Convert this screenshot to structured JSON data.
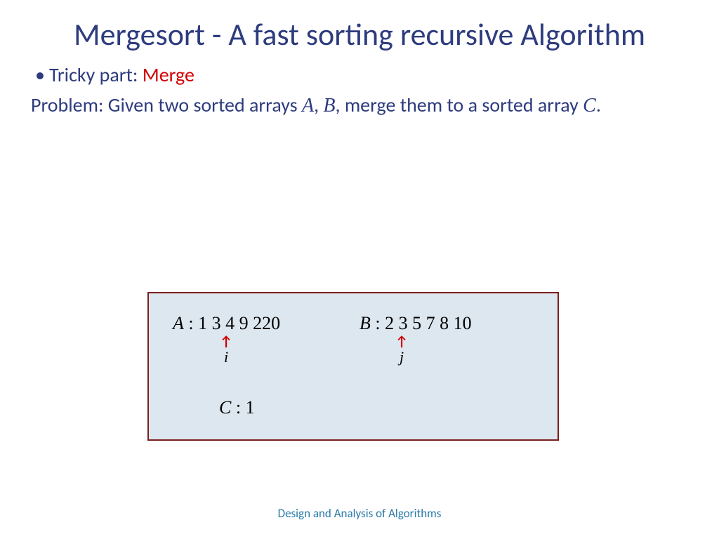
{
  "title": "Mergesort - A fast sorting recursive Algorithm",
  "bullet": {
    "prefix": "Tricky part: ",
    "emph": "Merge"
  },
  "problem": {
    "p1": "Problem: Given two sorted arrays ",
    "A": "A",
    "comma": ", ",
    "B": "B",
    "p2": ", merge them to a sorted array ",
    "C": "C",
    "period": "."
  },
  "diagram": {
    "A_label": "A",
    "A_values": "1 3 4 9 220",
    "B_label": "B",
    "B_values": "2 3 5 7 8 10",
    "C_label": "C",
    "C_values": "1",
    "ptr_i": "i",
    "ptr_j": "j",
    "arrow": "↑"
  },
  "footer": "Design and Analysis of Algorithms"
}
